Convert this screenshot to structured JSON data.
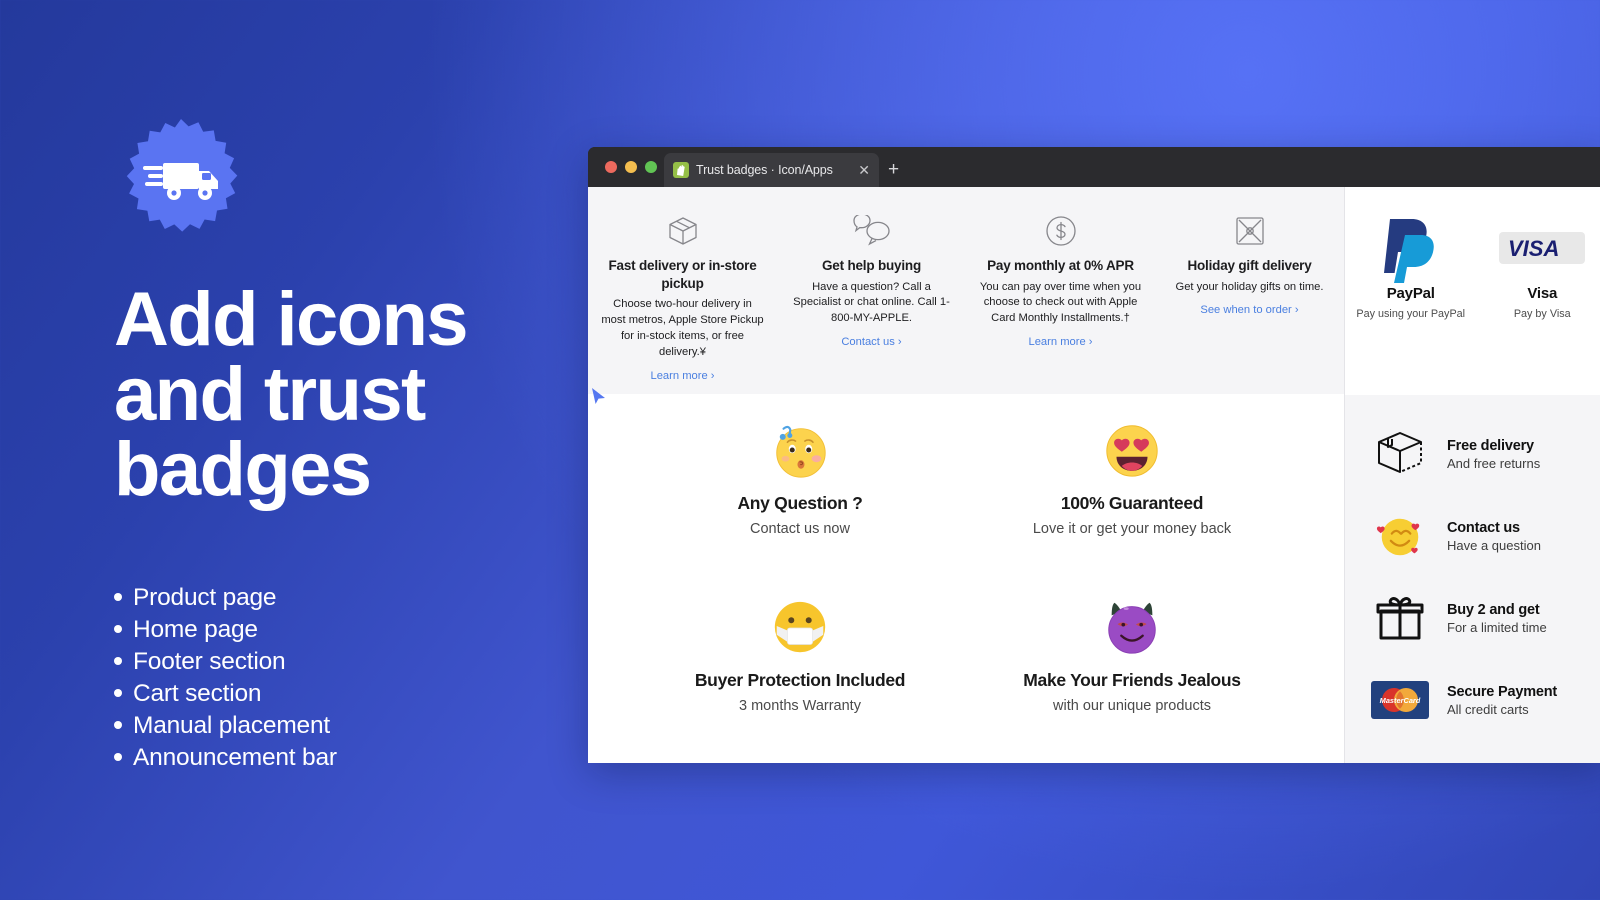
{
  "hero": {
    "badge_icon": "delivery-truck-icon",
    "title_lines": [
      "Add icons",
      "and trust",
      "badges"
    ],
    "bullets": [
      "Product page",
      "Home page",
      "Footer section",
      "Cart section",
      "Manual placement",
      "Announcement bar"
    ],
    "colors": {
      "background_dark": "#24399C",
      "background_light": "#5671F5",
      "text": "#FFFFFF"
    }
  },
  "browser": {
    "traffic_lights": [
      "close",
      "minimize",
      "zoom"
    ],
    "tab": {
      "favicon": "shopify-icon",
      "title": "Trust badges · Icon/Apps",
      "close_label": "✕"
    },
    "new_tab_label": "+"
  },
  "apple_strip": [
    {
      "icon": "box-icon",
      "heading": "Fast delivery or in-store pickup",
      "body": "Choose two-hour delivery in most metros, Apple Store Pickup for in-stock items, or free delivery.¥",
      "link": "Learn more ›"
    },
    {
      "icon": "chat-bubbles-icon",
      "heading": "Get help buying",
      "body": "Have a question? Call a Specialist or chat online. Call 1-800-MY-APPLE.",
      "link": "Contact us ›"
    },
    {
      "icon": "dollar-circle-icon",
      "heading": "Pay monthly at 0% APR",
      "body": "You can pay over time when you choose to check out with Apple Card Monthly Installments.†",
      "link": "Learn more ›"
    },
    {
      "icon": "gift-box-icon",
      "heading": "Holiday gift delivery",
      "body": "Get your holiday gifts on time.",
      "link": "See when to order ›"
    }
  ],
  "payment_strip": [
    {
      "logo": "paypal-logo",
      "heading": "PayPal",
      "body": "Pay using your PayPal"
    },
    {
      "logo": "visa-logo",
      "heading": "Visa",
      "body": "Pay by Visa"
    }
  ],
  "emoji_badges": [
    {
      "icon": "whistling-face-emoji",
      "heading": "Any Question ?",
      "body": "Contact us now"
    },
    {
      "icon": "heart-eyes-emoji",
      "heading": "100% Guaranteed",
      "body": "Love it or get your money back"
    },
    {
      "icon": "face-with-medical-mask-emoji",
      "heading": "Buyer Protection Included",
      "body": "3 months Warranty"
    },
    {
      "icon": "smiling-face-with-horns-emoji",
      "heading": "Make Your Friends Jealous",
      "body": "with our unique products"
    }
  ],
  "trust_list": [
    {
      "icon": "package-box-icon",
      "heading": "Free delivery",
      "body": "And free returns"
    },
    {
      "icon": "smiling-face-with-hearts-emoji",
      "heading": "Contact us",
      "body": "Have a question"
    },
    {
      "icon": "gift-icon",
      "heading": "Buy 2 and get",
      "body": "For a limited time"
    },
    {
      "icon": "mastercard-logo",
      "heading": "Secure Payment",
      "body": "All credit carts"
    }
  ]
}
